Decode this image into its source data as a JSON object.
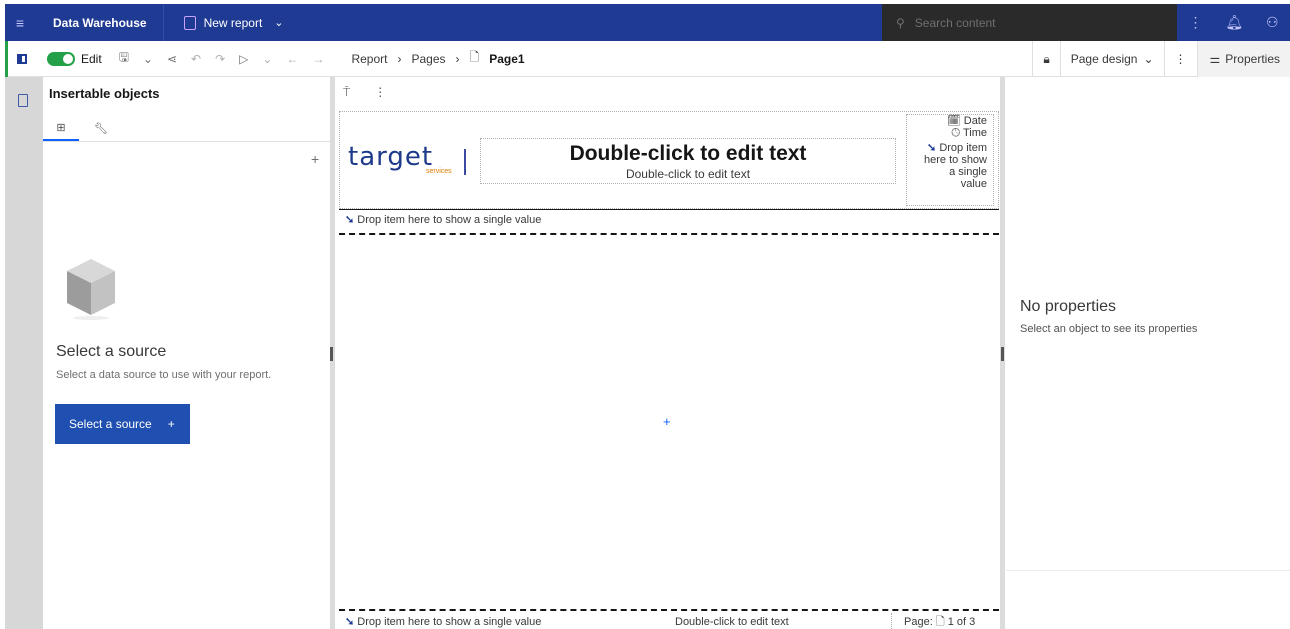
{
  "topbar": {
    "app_name": "Data Warehouse",
    "report_name": "New report",
    "search_placeholder": "Search content"
  },
  "toolbar": {
    "edit_label": "Edit",
    "breadcrumb": [
      "Report",
      "Pages",
      "Page1"
    ],
    "page_design_label": "Page design",
    "properties_label": "Properties"
  },
  "insertable": {
    "title": "Insertable objects",
    "source_title": "Select a source",
    "source_subtitle": "Select a data source to use with your report.",
    "source_button": "Select a source"
  },
  "canvas": {
    "logo_text": "target",
    "logo_sub": "services",
    "title_big": "Double-click to edit text",
    "title_small": "Double-click to edit text",
    "date_label": "Date",
    "time_label": "Time",
    "drop_item_small": [
      "Drop item",
      "here to show",
      "a single",
      "value"
    ],
    "drop_single": "Drop item here to show a single value",
    "footer_drop": "Drop item here to show a single value",
    "footer_text": "Double-click to edit text",
    "footer_page_label": "Page:",
    "footer_page_value": "1 of 3"
  },
  "properties": {
    "title": "No properties",
    "subtitle": "Select an object to see its properties"
  }
}
